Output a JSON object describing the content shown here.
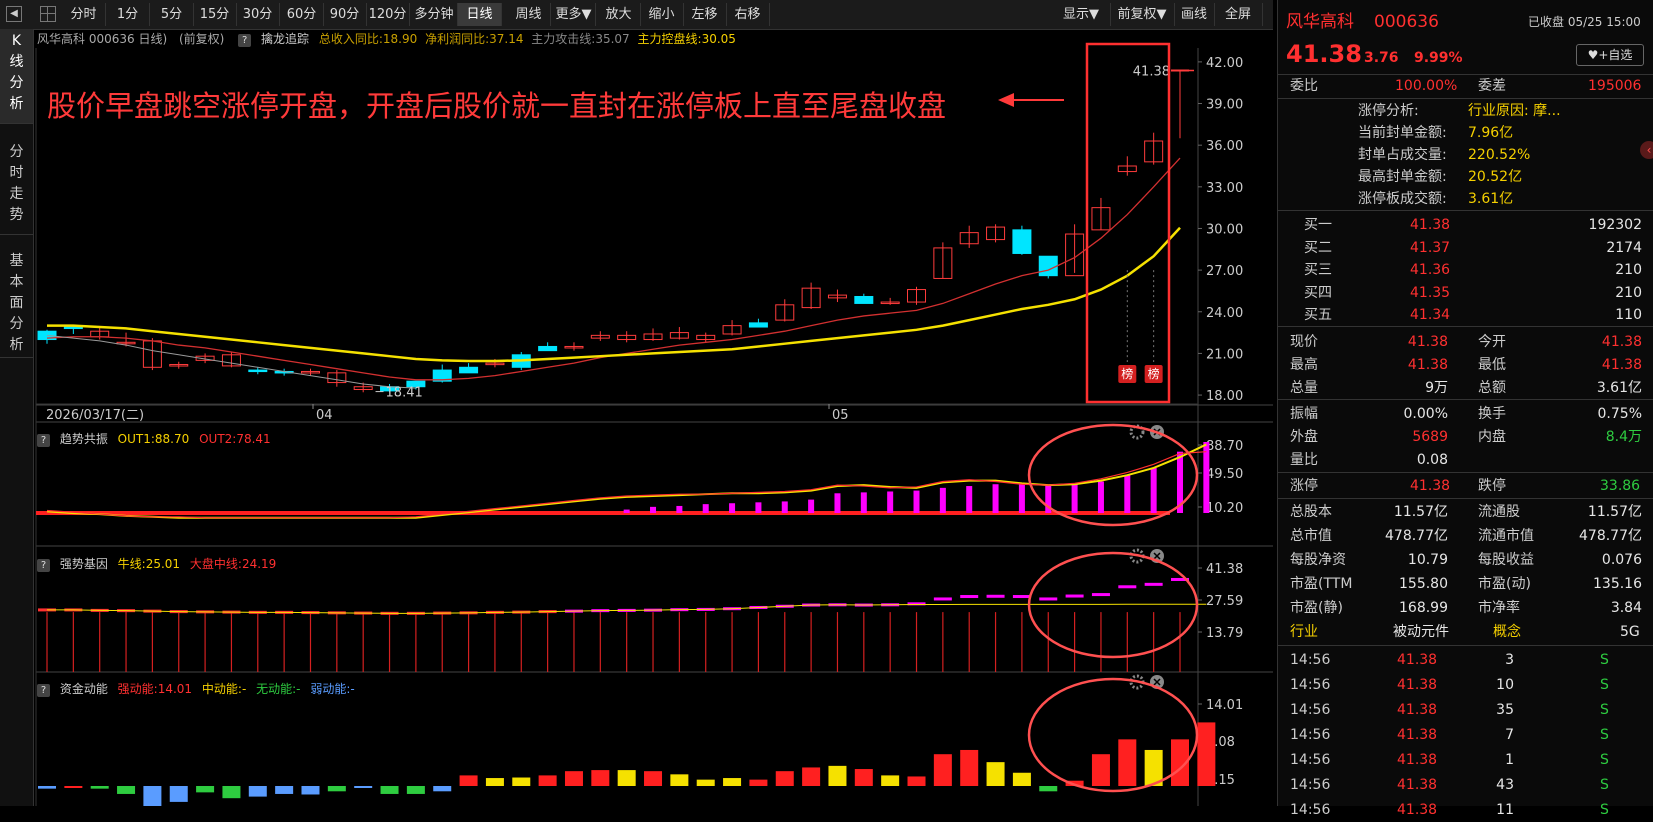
{
  "toolbar": {
    "periods": [
      "分时",
      "1分",
      "5分",
      "15分",
      "30分",
      "60分",
      "90分",
      "120分",
      "多分钟",
      "日线",
      "周线",
      "更多▼",
      "放大",
      "缩小",
      "左移",
      "右移"
    ],
    "active_period": "日线",
    "right_buttons": [
      "显示▼",
      "前复权▼",
      "画线",
      "全屏"
    ]
  },
  "sidebar": {
    "tabs": [
      "K线分析",
      "分时走势",
      "基本面分析"
    ],
    "active": "K线分析"
  },
  "kline": {
    "header": {
      "stock": "风华高科 000636 日线)",
      "adjust": "(前复权)",
      "q": "?",
      "indicator": "擒龙追踪",
      "item1": "总收入同比:18.90",
      "item2": "净利润同比:37.14",
      "item3": "主力攻击线:35.07",
      "item4": "主力控盘线:30.05"
    },
    "y_labels": [
      "42.00",
      "39.00",
      "36.00",
      "33.00",
      "30.00",
      "27.00",
      "24.00",
      "21.00",
      "18.00"
    ],
    "annotation": "股价早盘跳空涨停开盘，开盘后股价就一直封在涨停板上直至尾盘收盘",
    "last_price_label": "41.38",
    "low_label": "18.41",
    "bang_labels": [
      "榜",
      "榜"
    ],
    "x_labels": [
      "2026/03/17(二)",
      "04",
      "05"
    ]
  },
  "chart_data": [
    {
      "type": "candlestick",
      "title": "风华高科 000636 日线",
      "x_labels": [
        "2026/03/17(二)",
        "04",
        "05"
      ],
      "ylim": [
        17.5,
        43
      ],
      "open": [
        22.6,
        22.9,
        22.2,
        21.8,
        20.0,
        20.2,
        20.5,
        20.1,
        19.8,
        19.7,
        19.6,
        18.9,
        18.4,
        18.6,
        19.0,
        19.8,
        20.0,
        20.3,
        20.9,
        21.5,
        21.4,
        22.1,
        22.0,
        22.0,
        22.1,
        22.0,
        22.4,
        23.2,
        23.4,
        24.3,
        25.0,
        25.1,
        24.7,
        24.7,
        26.4,
        28.9,
        29.2,
        29.9,
        28.0,
        26.6,
        29.9,
        34.1,
        34.8,
        37.7
      ],
      "close": [
        22.0,
        22.8,
        22.6,
        21.8,
        21.9,
        20.2,
        20.8,
        20.9,
        19.7,
        19.6,
        19.7,
        19.6,
        18.6,
        18.3,
        18.6,
        19.0,
        19.6,
        20.3,
        20.0,
        21.2,
        21.5,
        22.3,
        22.3,
        22.4,
        22.5,
        22.3,
        23.0,
        22.9,
        24.5,
        25.7,
        25.2,
        24.6,
        24.7,
        25.6,
        28.6,
        29.7,
        30.1,
        28.2,
        26.6,
        29.6,
        31.5,
        34.5,
        36.3,
        37.8
      ],
      "high": [
        22.7,
        23.0,
        22.9,
        22.5,
        22.1,
        20.4,
        21.0,
        21.1,
        20.0,
        19.9,
        19.9,
        19.8,
        18.9,
        18.8,
        18.9,
        20.2,
        20.3,
        20.6,
        21.1,
        21.8,
        21.8,
        22.6,
        22.6,
        22.8,
        22.9,
        22.5,
        23.4,
        23.5,
        24.9,
        26.1,
        25.6,
        25.3,
        25.0,
        25.8,
        29.0,
        30.2,
        30.3,
        30.2,
        27.0,
        30.3,
        32.2,
        35.2,
        36.9,
        41.38
      ],
      "low": [
        21.7,
        22.4,
        22.0,
        21.5,
        19.8,
        19.9,
        20.3,
        20.0,
        19.5,
        19.4,
        19.4,
        18.6,
        18.2,
        18.2,
        18.4,
        18.9,
        19.8,
        20.0,
        19.8,
        21.2,
        21.2,
        21.9,
        21.8,
        21.9,
        22.0,
        21.8,
        22.3,
        22.9,
        23.3,
        24.2,
        24.7,
        24.6,
        24.5,
        24.5,
        26.4,
        28.6,
        29.0,
        28.1,
        26.4,
        26.8,
        29.9,
        33.8,
        34.6,
        36.5
      ],
      "series": [
        {
          "name": "主力攻击线",
          "color": "#d23030",
          "values": [
            22.1,
            22.2,
            22.2,
            22.1,
            21.9,
            21.6,
            21.4,
            21.1,
            20.8,
            20.5,
            20.2,
            19.9,
            19.6,
            19.3,
            19.1,
            19.1,
            19.2,
            19.4,
            19.7,
            20.0,
            20.3,
            20.7,
            21.0,
            21.3,
            21.6,
            21.8,
            22.0,
            22.3,
            22.6,
            23.0,
            23.4,
            23.7,
            23.9,
            24.1,
            24.6,
            25.3,
            26.0,
            26.6,
            27.0,
            27.9,
            29.3,
            31.0,
            33.0,
            35.07
          ]
        },
        {
          "name": "主力控盘线",
          "color": "#f5e100",
          "values": [
            23.0,
            23.0,
            22.9,
            22.8,
            22.6,
            22.4,
            22.2,
            22.0,
            21.8,
            21.6,
            21.4,
            21.2,
            21.0,
            20.8,
            20.6,
            20.5,
            20.45,
            20.45,
            20.5,
            20.6,
            20.7,
            20.8,
            20.9,
            21.0,
            21.1,
            21.2,
            21.3,
            21.5,
            21.7,
            21.9,
            22.1,
            22.3,
            22.5,
            22.7,
            23.0,
            23.4,
            23.8,
            24.2,
            24.5,
            24.9,
            25.6,
            26.6,
            28.0,
            30.05
          ]
        }
      ]
    },
    {
      "type": "bar+line",
      "title": "趋势共振",
      "ylim": [
        0,
        100
      ],
      "y_labels": [
        "88.70",
        "49.50",
        "10.20"
      ],
      "series": [
        {
          "name": "OUT1",
          "values": [
            88.7
          ]
        },
        {
          "name": "OUT2",
          "values": [
            78.41
          ]
        }
      ],
      "bars": [
        0,
        0,
        0,
        0,
        0,
        0,
        0,
        0,
        0,
        0,
        0,
        0,
        0,
        0,
        0,
        0,
        0,
        0,
        0,
        0,
        0,
        10,
        14,
        17,
        18,
        20,
        21,
        22,
        23,
        25,
        32,
        33,
        34,
        35,
        38,
        40,
        42,
        42,
        41,
        42,
        45,
        52,
        60,
        78,
        88.7
      ]
    },
    {
      "type": "bar",
      "title": "强势基因",
      "ylim": [
        0,
        46
      ],
      "y_labels": [
        "41.38",
        "27.59",
        "13.79"
      ],
      "series": [
        {
          "name": "牛线",
          "value": 25.01
        },
        {
          "name": "大盘中线",
          "value": 24.19
        }
      ]
    },
    {
      "type": "bar",
      "title": "资金动能",
      "ylim": [
        -2,
        16
      ],
      "y_labels": [
        "14.01",
        "7.08",
        "0.15"
      ],
      "series": [
        {
          "name": "强动能",
          "value": "14.01"
        },
        {
          "name": "中动能",
          "value": "-"
        },
        {
          "name": "无动能",
          "value": "-"
        },
        {
          "name": "弱动能",
          "value": "-"
        }
      ]
    }
  ],
  "ind1": {
    "title": "趋势共振",
    "q": "?",
    "out1": "OUT1:88.70",
    "out2": "OUT2:78.41",
    "y": [
      "88.70",
      "49.50",
      "10.20"
    ]
  },
  "ind2": {
    "title": "强势基因",
    "q": "?",
    "l1": "牛线:25.01",
    "l2": "大盘中线:24.19",
    "y": [
      "41.38",
      "27.59",
      "13.79"
    ]
  },
  "ind3": {
    "title": "资金动能",
    "q": "?",
    "l1": "强动能:14.01",
    "l2": "中动能:-",
    "l3": "无动能:-",
    "l4": "弱动能:-",
    "y": [
      "14.01",
      "7.08",
      "0.15"
    ]
  },
  "right": {
    "name": "风华高科",
    "code": "000636",
    "status": "已收盘 05/25 15:00",
    "price": "41.38",
    "change": "3.76",
    "pct": "9.99%",
    "add": "+自选",
    "weibi_l": "委比",
    "weibi_v": "100.00%",
    "weicha_l": "委差",
    "weicha_v": "195006",
    "limit": [
      {
        "l": "涨停分析:",
        "v": "行业原因: 摩..."
      },
      {
        "l": "当前封单金额:",
        "v": "7.96亿"
      },
      {
        "l": "封单占成交量:",
        "v": "220.52%"
      },
      {
        "l": "最高封单金额:",
        "v": "20.52亿"
      },
      {
        "l": "涨停板成交额:",
        "v": "3.61亿"
      }
    ],
    "bids": [
      {
        "l": "买一",
        "p": "41.38",
        "v": "192302"
      },
      {
        "l": "买二",
        "p": "41.37",
        "v": "2174"
      },
      {
        "l": "买三",
        "p": "41.36",
        "v": "210"
      },
      {
        "l": "买四",
        "p": "41.35",
        "v": "210"
      },
      {
        "l": "买五",
        "p": "41.34",
        "v": "110"
      }
    ],
    "quote": [
      [
        "现价",
        "41.38",
        "今开",
        "41.38"
      ],
      [
        "最高",
        "41.38",
        "最低",
        "41.38"
      ],
      [
        "总量",
        "9万",
        "总额",
        "3.61亿"
      ]
    ],
    "quote2": [
      [
        "振幅",
        "0.00%",
        "换手",
        "0.75%"
      ],
      [
        "外盘",
        "5689",
        "内盘",
        "8.4万"
      ],
      [
        "量比",
        "0.08",
        "",
        ""
      ]
    ],
    "zt": [
      "涨停",
      "41.38",
      "跌停",
      "33.86"
    ],
    "fund": [
      [
        "总股本",
        "11.57亿",
        "流通股",
        "11.57亿"
      ],
      [
        "总市值",
        "478.77亿",
        "流通市值",
        "478.77亿"
      ],
      [
        "每股净资",
        "10.79",
        "每股收益",
        "0.076"
      ],
      [
        "市盈(TTM",
        "155.80",
        "市盈(动)",
        "135.16"
      ],
      [
        "市盈(静)",
        "168.99",
        "市净率",
        "3.84"
      ]
    ],
    "industry": [
      "行业",
      "被动元件",
      "概念",
      "5G"
    ],
    "trades": [
      [
        "14:56",
        "41.38",
        "3",
        "S"
      ],
      [
        "14:56",
        "41.38",
        "10",
        "S"
      ],
      [
        "14:56",
        "41.38",
        "35",
        "S"
      ],
      [
        "14:56",
        "41.38",
        "7",
        "S"
      ],
      [
        "14:56",
        "41.38",
        "1",
        "S"
      ],
      [
        "14:56",
        "41.38",
        "43",
        "S"
      ],
      [
        "14:56",
        "41.38",
        "11",
        "S"
      ]
    ]
  }
}
